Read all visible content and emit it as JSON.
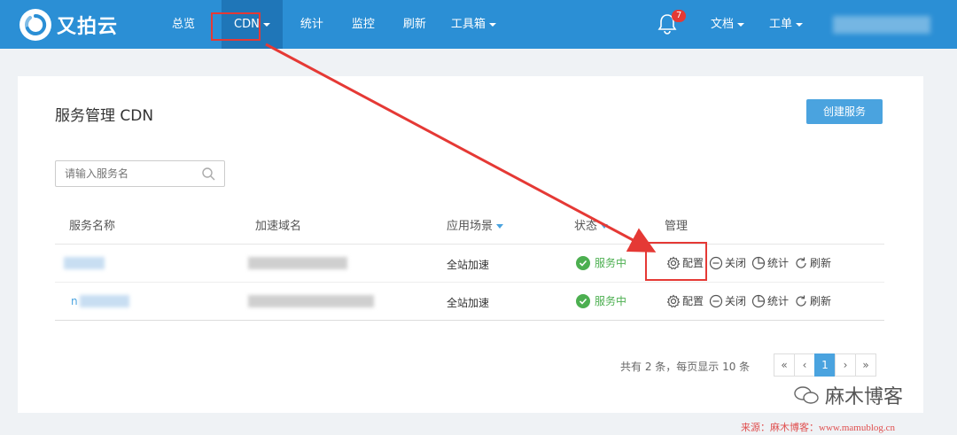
{
  "brand": {
    "name": "又拍云"
  },
  "nav": {
    "items": [
      {
        "label": "总览"
      },
      {
        "label": "CDN"
      },
      {
        "label": "统计"
      },
      {
        "label": "监控"
      },
      {
        "label": "刷新"
      },
      {
        "label": "工具箱"
      }
    ],
    "notification_count": "7",
    "docs_label": "文档",
    "ticket_label": "工单"
  },
  "page": {
    "title": "服务管理 CDN",
    "create_button": "创建服务",
    "search_placeholder": "请输入服务名"
  },
  "table": {
    "headers": {
      "name": "服务名称",
      "domain": "加速域名",
      "scenario": "应用场景",
      "status": "状态",
      "manage": "管理"
    },
    "rows": [
      {
        "name_prefix": "",
        "scenario": "全站加速",
        "status": "服务中"
      },
      {
        "name_prefix": "n",
        "scenario": "全站加速",
        "status": "服务中"
      }
    ],
    "actions": {
      "config": "配置",
      "close": "关闭",
      "stats": "统计",
      "refresh": "刷新"
    }
  },
  "pagination": {
    "info": "共有 2 条，每页显示 10 条",
    "first": "«",
    "prev": "‹",
    "current": "1",
    "next": "›",
    "last": "»"
  },
  "watermark": {
    "text": "麻木博客",
    "source": "来源：麻木博客：www.mamublog.cn"
  },
  "colors": {
    "nav_bg": "#2b8fd5",
    "nav_active": "#1f76b8",
    "accent": "#4aa3df",
    "success": "#4caf50",
    "annotation": "#e53935"
  }
}
